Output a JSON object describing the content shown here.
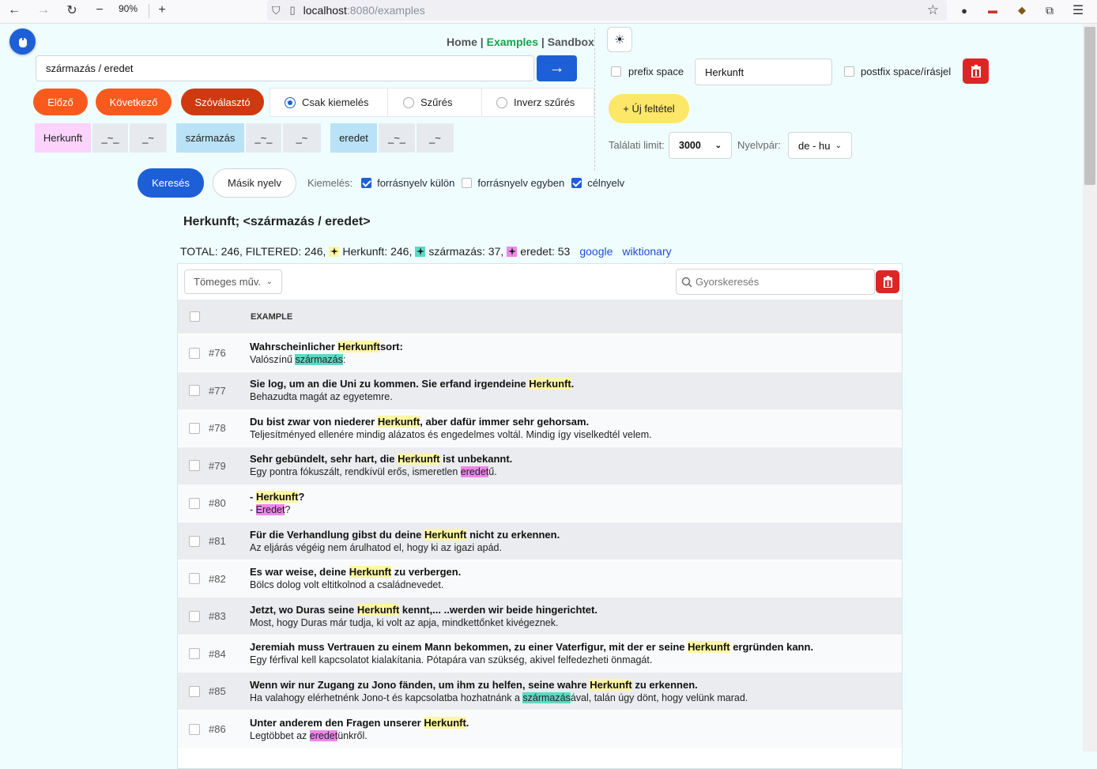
{
  "browser": {
    "zoom": "90%",
    "url_host": "localhost",
    "url_path": ":8080/examples"
  },
  "nav": {
    "home": "Home",
    "examples": "Examples",
    "sandbox": "Sandbox",
    "sep": "|"
  },
  "search": {
    "query": "származás / eredet",
    "arrow": "→"
  },
  "buttons": {
    "prev": "Előző",
    "next": "Következő",
    "selector": "Szóválasztó",
    "search": "Keresés",
    "other_lang": "Másik nyelv",
    "new_condition": "+ Új feltétel"
  },
  "modes": {
    "highlight_only": "Csak kiemelés",
    "filter": "Szűrés",
    "inverse_filter": "Inverz szűrés",
    "selected": "highlight_only"
  },
  "tokens": [
    {
      "word": "Herkunft",
      "a": "_~_",
      "b": "_~"
    },
    {
      "word": "származás",
      "a": "_~_",
      "b": "_~"
    },
    {
      "word": "eredet",
      "a": "_~_",
      "b": "_~"
    }
  ],
  "condition": {
    "prefix_label": "prefix space",
    "value": "Herkunft",
    "postfix_label": "postfix space/írásjel"
  },
  "limits": {
    "hit_limit_label": "Találati limit:",
    "hit_limit_value": "3000",
    "lang_pair_label": "Nyelvpár:",
    "lang_pair_value": "de - hu"
  },
  "highlight": {
    "label": "Kiemelés:",
    "src_separate": "forrásnyelv külön",
    "src_separate_checked": true,
    "src_together": "forrásnyelv egyben",
    "src_together_checked": false,
    "target": "célnyelv",
    "target_checked": true
  },
  "result": {
    "heading": "Herkunft; <származás / eredet>",
    "stats_prefix": "TOTAL: 246, FILTERED: 246,",
    "stat1": "Herkunft: 246,",
    "stat2": "származás: 37,",
    "stat3": "eredet: 53",
    "link_google": "google",
    "link_wiktionary": "wiktionary"
  },
  "colors": {
    "yellow": "#fdf6a3",
    "teal": "#5ed8c4",
    "magenta": "#ef86ea",
    "primary": "#1d5fd6",
    "orange": "#f85a1e"
  },
  "table": {
    "bulk_label": "Tömeges műv.",
    "quick_placeholder": "Gyorskeresés",
    "header_example": "EXAMPLE",
    "rows": [
      {
        "num": "#76",
        "src": [
          [
            "Wahrscheinlicher ",
            ""
          ],
          [
            "Herkunft",
            "y"
          ],
          [
            "sort:",
            ""
          ]
        ],
        "tgt": [
          [
            "Valószínű ",
            ""
          ],
          [
            "származás",
            "t"
          ],
          [
            ":",
            ""
          ]
        ]
      },
      {
        "num": "#77",
        "src": [
          [
            "Sie log, um an die Uni zu kommen. Sie erfand irgendeine ",
            ""
          ],
          [
            "Herkunft",
            "y"
          ],
          [
            ".",
            ""
          ]
        ],
        "tgt": [
          [
            "Behazudta magát az egyetemre.",
            ""
          ]
        ]
      },
      {
        "num": "#78",
        "src": [
          [
            "Du bist zwar von niederer ",
            ""
          ],
          [
            "Herkunft",
            "y"
          ],
          [
            ", aber dafür immer sehr gehorsam.",
            ""
          ]
        ],
        "tgt": [
          [
            "Teljesítményed ellenére mindig alázatos és engedelmes voltál. Mindig így viselkedtél velem.",
            ""
          ]
        ]
      },
      {
        "num": "#79",
        "src": [
          [
            "Sehr gebündelt, sehr hart, die ",
            ""
          ],
          [
            "Herkunft",
            "y"
          ],
          [
            " ist unbekannt.",
            ""
          ]
        ],
        "tgt": [
          [
            "Egy pontra fókuszált, rendkívül erős, ismeretlen ",
            ""
          ],
          [
            "eredet",
            "m"
          ],
          [
            "ű.",
            ""
          ]
        ]
      },
      {
        "num": "#80",
        "src": [
          [
            "- ",
            ""
          ],
          [
            "Herkunft",
            "y"
          ],
          [
            "?",
            ""
          ]
        ],
        "tgt": [
          [
            "- ",
            ""
          ],
          [
            "Eredet",
            "m"
          ],
          [
            "?",
            ""
          ]
        ]
      },
      {
        "num": "#81",
        "src": [
          [
            "Für die Verhandlung gibst du deine ",
            ""
          ],
          [
            "Herkunft",
            "y"
          ],
          [
            " nicht zu erkennen.",
            ""
          ]
        ],
        "tgt": [
          [
            "Az eljárás végéig nem árulhatod el, hogy ki az igazi apád.",
            ""
          ]
        ]
      },
      {
        "num": "#82",
        "src": [
          [
            "Es war weise, deine ",
            ""
          ],
          [
            "Herkunft",
            "y"
          ],
          [
            " zu verbergen.",
            ""
          ]
        ],
        "tgt": [
          [
            "Bölcs dolog volt eltitkolnod a családnevedet.",
            ""
          ]
        ]
      },
      {
        "num": "#83",
        "src": [
          [
            "Jetzt, wo Duras seine ",
            ""
          ],
          [
            "Herkunft",
            "y"
          ],
          [
            " kennt,... ..werden wir beide hingerichtet.",
            ""
          ]
        ],
        "tgt": [
          [
            "Most, hogy Duras már tudja, ki volt az apja, mindkettőnket kivégeznek.",
            ""
          ]
        ]
      },
      {
        "num": "#84",
        "src": [
          [
            "Jeremiah muss Vertrauen zu einem Mann bekommen, zu einer Vaterfigur, mit der er seine ",
            ""
          ],
          [
            "Herkunft",
            "y"
          ],
          [
            " ergründen kann.",
            ""
          ]
        ],
        "tgt": [
          [
            "Egy férfival kell kapcsolatot kialakítania. Pótapára van szükség, akivel felfedezheti önmagát.",
            ""
          ]
        ]
      },
      {
        "num": "#85",
        "src": [
          [
            "Wenn wir nur Zugang zu Jono fänden, um ihm zu helfen, seine wahre ",
            ""
          ],
          [
            "Herkunft",
            "y"
          ],
          [
            " zu erkennen.",
            ""
          ]
        ],
        "tgt": [
          [
            "Ha valahogy elérhetnénk Jono-t és kapcsolatba hozhatnánk a ",
            ""
          ],
          [
            "származás",
            "t"
          ],
          [
            "ával, talán úgy dönt, hogy velünk marad.",
            ""
          ]
        ]
      },
      {
        "num": "#86",
        "src": [
          [
            "Unter anderem den Fragen unserer ",
            ""
          ],
          [
            "Herkunft",
            "y"
          ],
          [
            ".",
            ""
          ]
        ],
        "tgt": [
          [
            "Legtöbbet az ",
            ""
          ],
          [
            "eredet",
            "m"
          ],
          [
            "ünkről.",
            ""
          ]
        ]
      }
    ]
  }
}
